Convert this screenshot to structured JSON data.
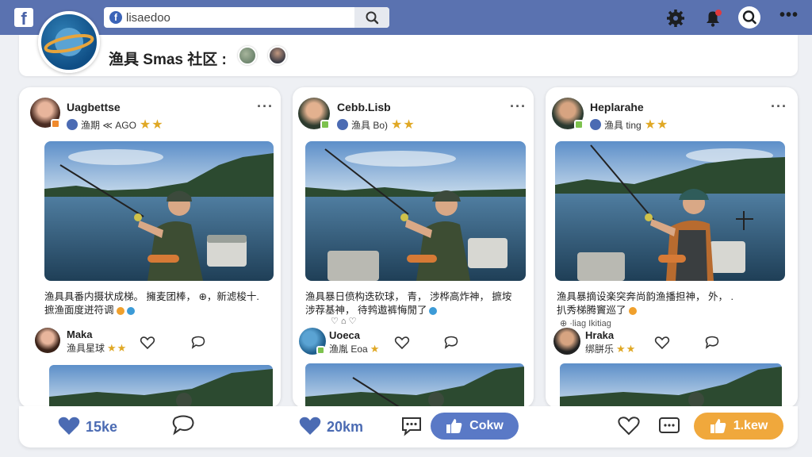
{
  "topbar": {
    "logo_letter": "f",
    "search_value": "lisaedoo",
    "icons": [
      "facebook-logo-icon",
      "search-icon",
      "settings-gear-icon",
      "notifications-bell-icon",
      "search-icon",
      "more-dots-icon"
    ],
    "colors": {
      "bar": "#5a72b0",
      "brand": "#3b64b8"
    }
  },
  "group": {
    "name": "渔具 Smas 社区 :"
  },
  "posts": [
    {
      "author": "Uagbettse",
      "meta": "渔期 ≪ AGO",
      "stars": "★★",
      "caption_line1": "渔具具番内摄状成梯。 擁麦团棒， ⊕，新滤梭十.",
      "caption_line2": "摭渔面度迸符调",
      "comment_author": "Maka",
      "comment_text": "渔具星球",
      "comment_stars": "★★"
    },
    {
      "author": "Cebb.Lisb",
      "meta": "渔具 Bo)",
      "stars": "★★",
      "caption_line1": "渔具暴日偾构迭砍球， 青， 涉桦高炸神， 摭垵",
      "caption_line2": "涉荐基神， 待鹁遨裤悔閒了",
      "comment_author": "Uoeca",
      "comment_text": "渔胤 Eoa",
      "comment_stars": "★"
    },
    {
      "author": "Heplarahe",
      "meta": "渔具 ting",
      "stars": "★★",
      "caption_line1": "渔具暴摘设楽突奔尚韵渔播担神， 外， .",
      "caption_line2": "扒秀梯腾竇巡了",
      "sub_line": "⊕ ·liag Ikitiag",
      "comment_author": "Hraka",
      "comment_text": "绑胼乐",
      "comment_stars": "★★"
    }
  ],
  "actions": {
    "like_count_1": "15ke",
    "like_count_2": "20km",
    "comment_label": "Cokw",
    "like_label_3": "1.kew",
    "colors": {
      "accent": "#4b6bb3",
      "pill_blue": "#5a79c6",
      "pill_orange": "#f0a83c"
    }
  }
}
